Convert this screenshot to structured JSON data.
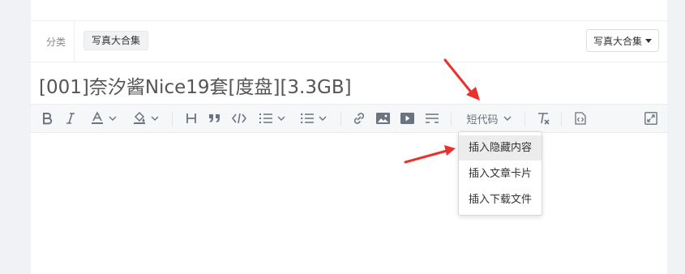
{
  "category": {
    "label": "分类",
    "selected_tag": "写真大合集",
    "select_value": "写真大合集"
  },
  "post": {
    "title": "[001]奈汐酱Nice19套[度盘][3.3GB]"
  },
  "toolbar": {
    "buttons": [
      {
        "name": "bold",
        "icon": "bold-icon"
      },
      {
        "name": "italic",
        "icon": "italic-icon"
      },
      {
        "name": "font-color",
        "icon": "font-color-icon"
      },
      {
        "name": "highlight",
        "icon": "paint-bucket-icon"
      },
      {
        "name": "heading",
        "icon": "heading-icon"
      },
      {
        "name": "quote",
        "icon": "quote-icon"
      },
      {
        "name": "code",
        "icon": "code-icon"
      },
      {
        "name": "ordered-list",
        "icon": "ordered-list-icon"
      },
      {
        "name": "unordered-list",
        "icon": "unordered-list-icon"
      },
      {
        "name": "link",
        "icon": "link-icon"
      },
      {
        "name": "image",
        "icon": "image-icon"
      },
      {
        "name": "video",
        "icon": "video-icon"
      },
      {
        "name": "horizontal-rule",
        "icon": "hr-icon"
      },
      {
        "name": "clear-format",
        "icon": "clear-format-icon"
      },
      {
        "name": "source",
        "icon": "source-code-icon"
      },
      {
        "name": "fullscreen",
        "icon": "fullscreen-icon"
      }
    ],
    "shortcode_label": "短代码"
  },
  "shortcode_menu": {
    "items": [
      {
        "label": "插入隐藏内容",
        "active": true
      },
      {
        "label": "插入文章卡片",
        "active": false
      },
      {
        "label": "插入下载文件",
        "active": false
      }
    ]
  },
  "colors": {
    "icon": "#6b7280",
    "annotation_arrow": "#e8322f",
    "toolbar_bg": "#f6f7f9",
    "menu_hover": "#ececec"
  }
}
